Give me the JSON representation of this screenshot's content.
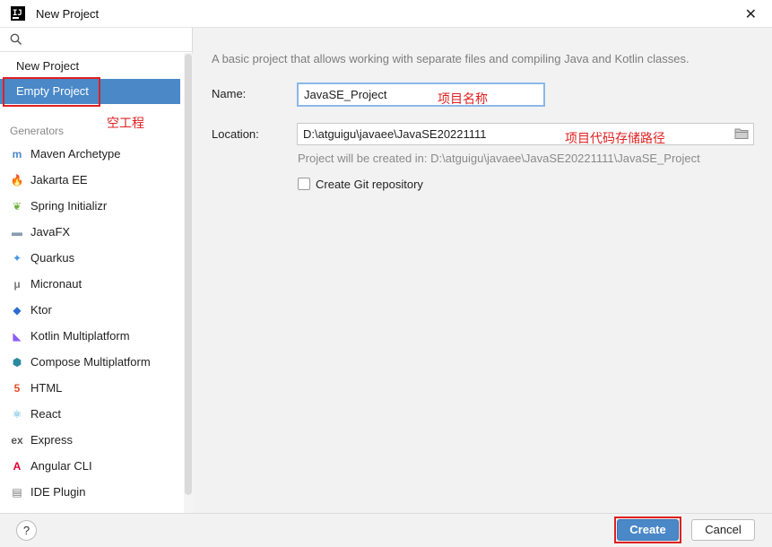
{
  "window": {
    "title": "New Project"
  },
  "sidebar": {
    "search_placeholder": "",
    "items": [
      {
        "label": "New Project",
        "selected": false
      },
      {
        "label": "Empty Project",
        "selected": true
      }
    ],
    "section_label": "Generators",
    "generators": [
      {
        "label": "Maven Archetype",
        "icon": "maven-icon",
        "glyph": "m",
        "color": "#4a88c7"
      },
      {
        "label": "Jakarta EE",
        "icon": "jakarta-icon",
        "glyph": "🔥",
        "color": "#f29111"
      },
      {
        "label": "Spring Initializr",
        "icon": "spring-icon",
        "glyph": "❦",
        "color": "#6db33f"
      },
      {
        "label": "JavaFX",
        "icon": "javafx-icon",
        "glyph": "▬",
        "color": "#8a9bb0"
      },
      {
        "label": "Quarkus",
        "icon": "quarkus-icon",
        "glyph": "✦",
        "color": "#4695eb"
      },
      {
        "label": "Micronaut",
        "icon": "micronaut-icon",
        "glyph": "μ",
        "color": "#7a7a7a"
      },
      {
        "label": "Ktor",
        "icon": "ktor-icon",
        "glyph": "◆",
        "color": "#2d6bd4"
      },
      {
        "label": "Kotlin Multiplatform",
        "icon": "kotlin-icon",
        "glyph": "◣",
        "color": "#8a5cf6"
      },
      {
        "label": "Compose Multiplatform",
        "icon": "compose-icon",
        "glyph": "⬢",
        "color": "#2b8a9e"
      },
      {
        "label": "HTML",
        "icon": "html5-icon",
        "glyph": "5",
        "color": "#e44d26"
      },
      {
        "label": "React",
        "icon": "react-icon",
        "glyph": "⚛",
        "color": "#3ba7d6"
      },
      {
        "label": "Express",
        "icon": "express-icon",
        "glyph": "ex",
        "color": "#555555"
      },
      {
        "label": "Angular CLI",
        "icon": "angular-icon",
        "glyph": "A",
        "color": "#dd0031"
      },
      {
        "label": "IDE Plugin",
        "icon": "plugin-icon",
        "glyph": "▤",
        "color": "#7a7a7a"
      }
    ]
  },
  "form": {
    "description": "A basic project that allows working with separate files and compiling Java and Kotlin classes.",
    "name_label": "Name:",
    "name_value": "JavaSE_Project",
    "location_label": "Location:",
    "location_value": "D:\\atguigu\\javaee\\JavaSE20221111",
    "hint": "Project will be created in: D:\\atguigu\\javaee\\JavaSE20221111\\JavaSE_Project",
    "git_checkbox_label": "Create Git repository",
    "git_checked": false
  },
  "annotations": {
    "empty_project": "空工程",
    "project_name": "项目名称",
    "code_path": "项目代码存储路径"
  },
  "footer": {
    "help": "?",
    "create": "Create",
    "cancel": "Cancel"
  },
  "colors": {
    "accent": "#4a88c7",
    "annotation_red": "#e02020"
  }
}
